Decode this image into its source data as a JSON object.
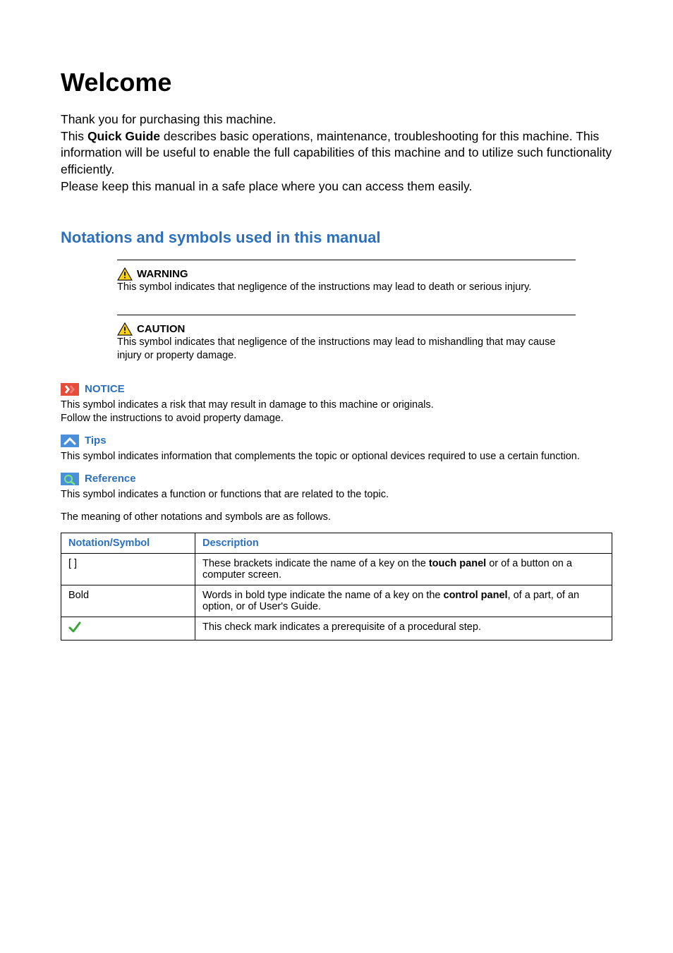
{
  "title": "Welcome",
  "intro": {
    "line1": "Thank you for purchasing this machine.",
    "line2a": "This ",
    "line2b": "Quick Guide",
    "line2c": " describes basic operations, maintenance, troubleshooting for this machine. This information will be useful to enable the full capabilities of this machine and to utilize such functionality efficiently.",
    "line3": "Please keep this manual in a safe place where you can access them easily."
  },
  "section_heading": "Notations and symbols used in this manual",
  "warning": {
    "label": "WARNING",
    "desc": "This symbol indicates that negligence of the instructions may lead to death or serious injury."
  },
  "caution": {
    "label": "CAUTION",
    "desc": "This symbol indicates that negligence of the instructions may lead to mishandling that may cause injury or property damage."
  },
  "notice": {
    "label": "NOTICE",
    "desc1": "This symbol indicates a risk that may result in damage to this machine or originals.",
    "desc2": "Follow the instructions to avoid property damage."
  },
  "tips": {
    "label": "Tips",
    "desc": "This symbol indicates information that complements the topic or optional devices required to use a certain function."
  },
  "reference": {
    "label": "Reference",
    "desc": "This symbol indicates a function or functions that are related to the topic."
  },
  "meaning_line": "The meaning of other notations and symbols are as follows.",
  "table": {
    "header_symbol": "Notation/Symbol",
    "header_desc": "Description",
    "row1_symbol": "[ ]",
    "row1_a": "These brackets indicate the name of a key on the ",
    "row1_b": "touch panel",
    "row1_c": " or of a button on a computer screen.",
    "row2_symbol": "Bold",
    "row2_a": "Words in bold type indicate the name of a key on the ",
    "row2_b": "control panel",
    "row2_c": ", of a part, of an option, or of User's Guide.",
    "row3_desc": "This check mark indicates a prerequisite of a procedural step."
  }
}
